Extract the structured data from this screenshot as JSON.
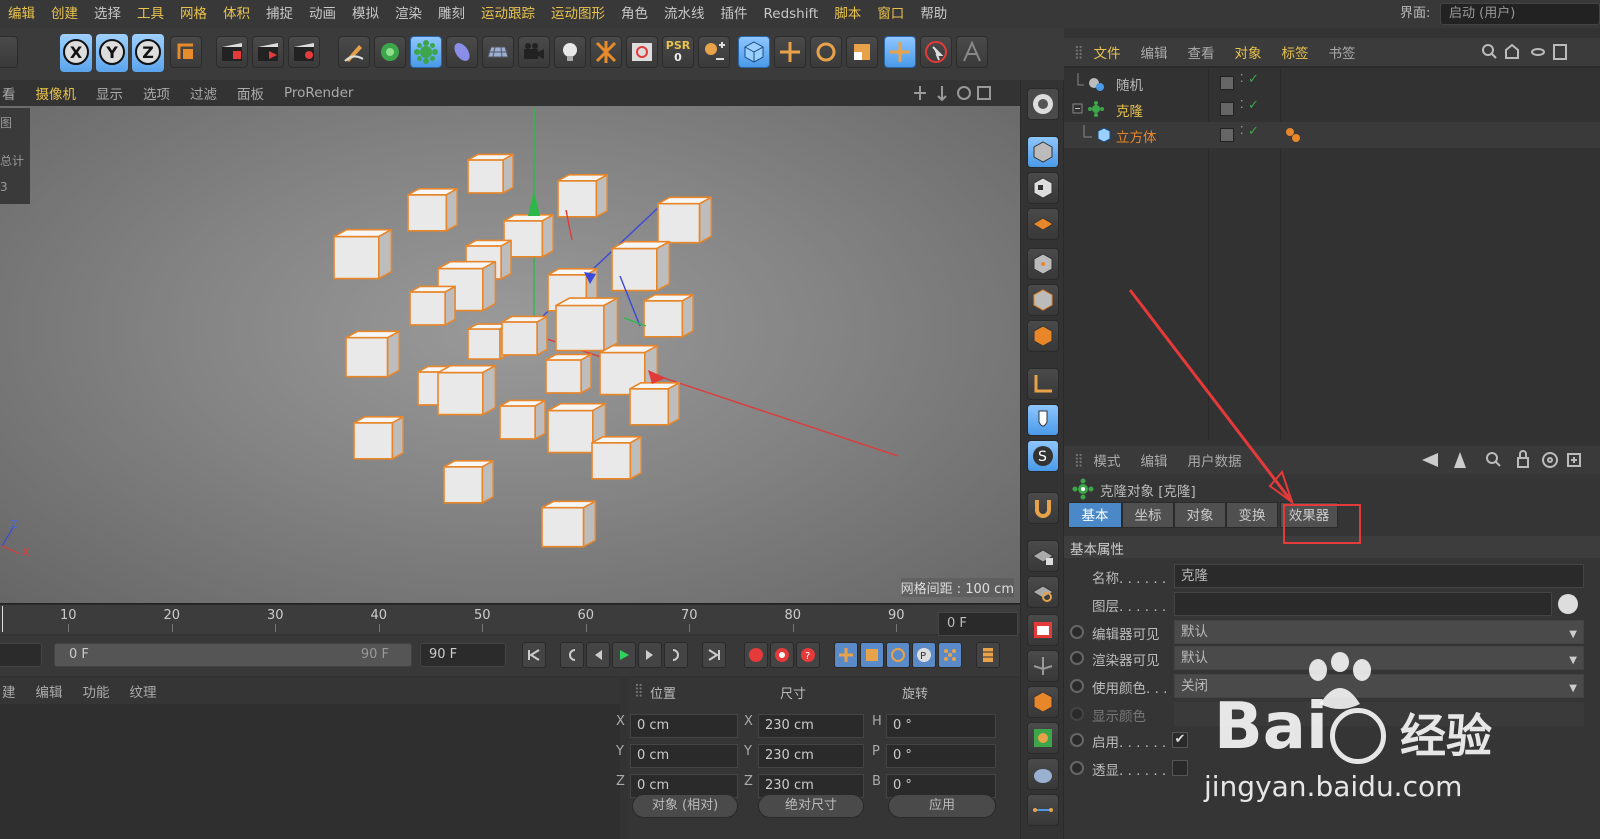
{
  "menubar": {
    "items": [
      {
        "label": "编辑",
        "hl": true
      },
      {
        "label": "创建",
        "hl": true
      },
      {
        "label": "选择",
        "hl": false
      },
      {
        "label": "工具",
        "hl": true
      },
      {
        "label": "网格",
        "hl": true
      },
      {
        "label": "体积",
        "hl": true
      },
      {
        "label": "捕捉",
        "hl": false
      },
      {
        "label": "动画",
        "hl": false
      },
      {
        "label": "模拟",
        "hl": false
      },
      {
        "label": "渲染",
        "hl": false
      },
      {
        "label": "雕刻",
        "hl": false
      },
      {
        "label": "运动跟踪",
        "hl": true
      },
      {
        "label": "运动图形",
        "hl": true
      },
      {
        "label": "角色",
        "hl": false
      },
      {
        "label": "流水线",
        "hl": false
      },
      {
        "label": "插件",
        "hl": false
      },
      {
        "label": "Redshift",
        "hl": false
      },
      {
        "label": "脚本",
        "hl": true
      },
      {
        "label": "窗口",
        "hl": true
      },
      {
        "label": "帮助",
        "hl": false
      }
    ],
    "layout_label": "界面:",
    "layout_value": "启动 (用户)"
  },
  "toolbar": {
    "axes": [
      "X",
      "Y",
      "Z"
    ],
    "psr_label": "PSR",
    "psr_value": "0"
  },
  "viewport_menu": [
    {
      "label": "看",
      "hl": false
    },
    {
      "label": "摄像机",
      "hl": true
    },
    {
      "label": "显示",
      "hl": false
    },
    {
      "label": "选项",
      "hl": false
    },
    {
      "label": "过滤",
      "hl": false
    },
    {
      "label": "面板",
      "hl": false
    },
    {
      "label": "ProRender",
      "hl": false
    }
  ],
  "viewport": {
    "left_strip": [
      "图",
      "总计",
      "3"
    ],
    "grid_spacing": "网格间距 : 100 cm",
    "axis_labels": {
      "z": "Z",
      "x": "X"
    }
  },
  "timeline": {
    "ticks": [
      "10",
      "20",
      "30",
      "40",
      "50",
      "60",
      "70",
      "80",
      "90"
    ],
    "current_frame": "0 F"
  },
  "playback": {
    "range_start": "0 F",
    "range_end": "90 F",
    "max_frame": "90 F"
  },
  "material_panel": {
    "menu": [
      "建",
      "编辑",
      "功能",
      "纹理"
    ]
  },
  "coordinates": {
    "header": {
      "position": "位置",
      "size": "尺寸",
      "rotation": "旋转"
    },
    "rows": [
      {
        "axis": "X",
        "pos": "0 cm",
        "size_axis": "X",
        "size": "230 cm",
        "rot_axis": "H",
        "rot": "0 °"
      },
      {
        "axis": "Y",
        "pos": "0 cm",
        "size_axis": "Y",
        "size": "230 cm",
        "rot_axis": "P",
        "rot": "0 °"
      },
      {
        "axis": "Z",
        "pos": "0 cm",
        "size_axis": "Z",
        "size": "230 cm",
        "rot_axis": "B",
        "rot": "0 °"
      }
    ],
    "mode": "对象 (相对)",
    "size_mode": "绝对尺寸",
    "apply": "应用"
  },
  "object_manager": {
    "menu": [
      {
        "label": "文件",
        "hl": true
      },
      {
        "label": "编辑",
        "hl": false
      },
      {
        "label": "查看",
        "hl": false
      },
      {
        "label": "对象",
        "hl": true
      },
      {
        "label": "标签",
        "hl": true
      },
      {
        "label": "书签",
        "hl": false
      }
    ],
    "objects": [
      {
        "name": "随机",
        "color": "#bbbbbb"
      },
      {
        "name": "克隆",
        "color": "#e8c24e"
      },
      {
        "name": "立方体",
        "color": "#e8862a"
      }
    ]
  },
  "attributes": {
    "menu": [
      "模式",
      "编辑",
      "用户数据"
    ],
    "object_title": "克隆对象 [克隆]",
    "tabs": [
      "基本",
      "坐标",
      "对象",
      "变换",
      "效果器"
    ],
    "active_tab": 0,
    "section": "基本属性",
    "fields": [
      {
        "label": "名称. . . . . .",
        "value": "克隆",
        "type": "text"
      },
      {
        "label": "图层. . . . . .",
        "value": "",
        "type": "text"
      },
      {
        "label": "编辑器可见",
        "value": "默认",
        "type": "dropdown"
      },
      {
        "label": "渲染器可见",
        "value": "默认",
        "type": "dropdown"
      },
      {
        "label": "使用颜色. . .",
        "value": "关闭",
        "type": "dropdown"
      },
      {
        "label": "显示颜色",
        "value": "",
        "type": "color"
      },
      {
        "label": "启用. . . . . .",
        "value": "✔",
        "type": "check"
      },
      {
        "label": "透显. . . . . .",
        "value": "",
        "type": "check"
      }
    ]
  },
  "watermark": {
    "brand": "Bai",
    "suffix": "经验",
    "url": "jingyan.baidu.com"
  },
  "colors": {
    "accent_yellow": "#e8c24e",
    "selected_blue": "#4a88c8",
    "highlight_red": "#e53a3a",
    "cube_outline": "#e8862a"
  }
}
